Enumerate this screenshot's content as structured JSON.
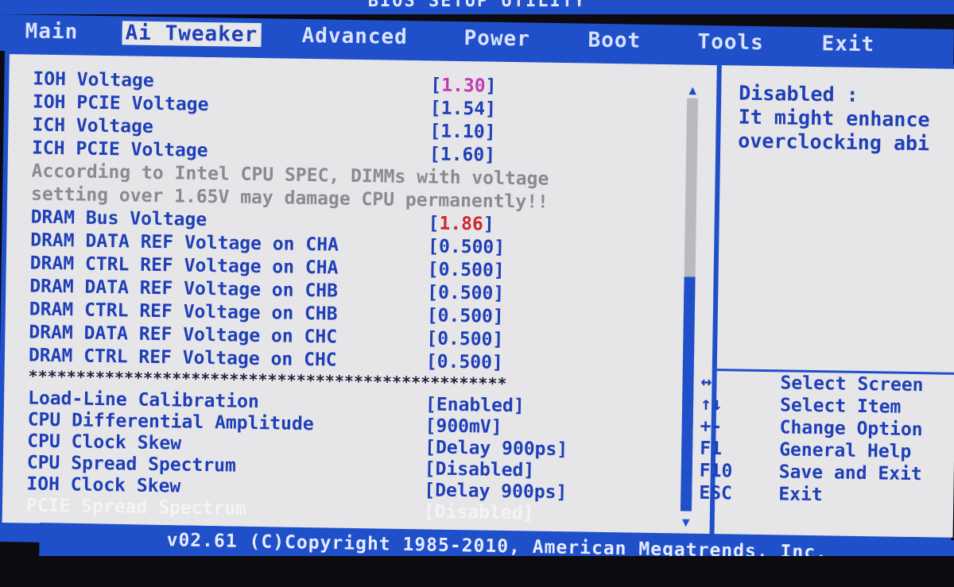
{
  "title": "BIOS SETUP UTILITY",
  "menu": [
    {
      "label": "Main",
      "active": false
    },
    {
      "label": "Ai Tweaker",
      "active": true
    },
    {
      "label": "Advanced",
      "active": false
    },
    {
      "label": "Power",
      "active": false
    },
    {
      "label": "Boot",
      "active": false
    },
    {
      "label": "Tools",
      "active": false
    },
    {
      "label": "Exit",
      "active": false
    }
  ],
  "settings": [
    {
      "label": "IOH Voltage",
      "value_open": "[",
      "value": "1.30",
      "value_close": "]"
    },
    {
      "label": "IOH PCIE Voltage",
      "value_open": "[",
      "value": "1.54",
      "value_close": "]"
    },
    {
      "label": "ICH Voltage",
      "value_open": "[",
      "value": "1.10",
      "value_close": "]"
    },
    {
      "label": "ICH PCIE Voltage",
      "value_open": "[",
      "value": "1.60",
      "value_close": "]"
    },
    {
      "label": "DRAM Bus Voltage",
      "value_open": "[",
      "value": "1.86",
      "value_close": "]"
    },
    {
      "label": "DRAM DATA REF Voltage on CHA",
      "value_open": "[",
      "value": "0.500",
      "value_close": "]"
    },
    {
      "label": "DRAM CTRL REF Voltage on CHA",
      "value_open": "[",
      "value": "0.500",
      "value_close": "]"
    },
    {
      "label": "DRAM DATA REF Voltage on CHB",
      "value_open": "[",
      "value": "0.500",
      "value_close": "]"
    },
    {
      "label": "DRAM CTRL REF Voltage on CHB",
      "value_open": "[",
      "value": "0.500",
      "value_close": "]"
    },
    {
      "label": "DRAM DATA REF Voltage on CHC",
      "value_open": "[",
      "value": "0.500",
      "value_close": "]"
    },
    {
      "label": "DRAM CTRL REF Voltage on CHC",
      "value_open": "[",
      "value": "0.500",
      "value_close": "]"
    },
    {
      "label": "Load-Line Calibration",
      "value_open": "[",
      "value": "Enabled",
      "value_close": "]"
    },
    {
      "label": "CPU Differential Amplitude",
      "value_open": "[",
      "value": "900mV",
      "value_close": "]"
    },
    {
      "label": "CPU Clock Skew",
      "value_open": "[",
      "value": "Delay 900ps",
      "value_close": "]"
    },
    {
      "label": "CPU Spread Spectrum",
      "value_open": "[",
      "value": "Disabled",
      "value_close": "]"
    },
    {
      "label": "IOH Clock Skew",
      "value_open": "[",
      "value": "Delay 900ps",
      "value_close": "]"
    },
    {
      "label": "PCIE Spread Spectrum",
      "value_open": "[",
      "value": "Disabled",
      "value_close": "]"
    }
  ],
  "warning": {
    "line1": "According to Intel CPU SPEC, DIMMs with voltage",
    "line2": "setting over 1.65V may damage CPU permanently!!"
  },
  "separator": "**************************************************",
  "help": {
    "line1": "Disabled :",
    "line2": "It might enhance",
    "line3": "overclocking abi"
  },
  "keys": [
    {
      "key": "↔",
      "desc": "Select Screen"
    },
    {
      "key": "↑↓",
      "desc": "Select Item"
    },
    {
      "key": "+-",
      "desc": "Change Option"
    },
    {
      "key": "F1",
      "desc": "General Help"
    },
    {
      "key": "F10",
      "desc": "Save and Exit"
    },
    {
      "key": "ESC",
      "desc": "Exit"
    }
  ],
  "footer": "v02.61 (C)Copyright 1985-2010, American Megatrends, Inc.",
  "colors": {
    "frame_blue": "#1f4fc9",
    "panel_bg": "#e6e6e9",
    "text_blue": "#1f3fb8",
    "highlight_pink": "#c23ab4",
    "highlight_red": "#d2262e",
    "warning_gray": "#8a8a8f"
  }
}
